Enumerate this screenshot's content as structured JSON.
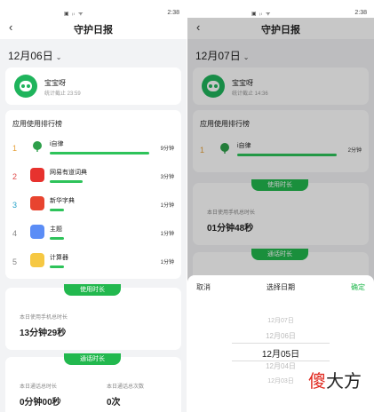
{
  "status": {
    "time": "2:38",
    "icons_left": "▣ ᵢₗ ᯤ",
    "icons_right": "◉ ✕ ⊛ ▭"
  },
  "header": {
    "title": "守护日报",
    "back": "‹"
  },
  "left": {
    "date": "12月06日",
    "user": {
      "name": "宝宝呀",
      "subtitle": "统计截止 23:59"
    },
    "ranking": {
      "title": "应用使用排行榜",
      "items": [
        {
          "rank": "1",
          "name": "i自律",
          "time": "9分钟",
          "ratio": 1.0,
          "color": "#e6a23c",
          "icon_color": "#ffffff"
        },
        {
          "rank": "2",
          "name": "网易有道词典",
          "time": "3分钟",
          "ratio": 0.33,
          "color": "#e04b4b",
          "icon_color": "#e7322e",
          "icon_text": "有道"
        },
        {
          "rank": "3",
          "name": "新华字典",
          "time": "1分钟",
          "ratio": 0.14,
          "color": "#27a3c9",
          "icon_color": "#e8442f",
          "icon_text": "新华"
        },
        {
          "rank": "4",
          "name": "主题",
          "time": "1分钟",
          "ratio": 0.14,
          "color": "#888888",
          "icon_color": "#5b8df6"
        },
        {
          "rank": "5",
          "name": "计算器",
          "time": "1分钟",
          "ratio": 0.14,
          "color": "#888888",
          "icon_color": "#f6c843"
        }
      ]
    },
    "usage": {
      "pill": "使用时长",
      "label": "本日使用手机总时长",
      "value": "13分钟29秒"
    },
    "calls": {
      "pill": "通话时长",
      "label_duration": "本日通话总时长",
      "value_duration": "0分钟00秒",
      "label_count": "本日通话总次数",
      "value_count": "0次"
    }
  },
  "right": {
    "date": "12月07日",
    "user": {
      "name": "宝宝呀",
      "subtitle": "统计截止 14:36"
    },
    "ranking": {
      "title": "应用使用排行榜",
      "items": [
        {
          "rank": "1",
          "name": "i自律",
          "time": "2分钟",
          "ratio": 1.0
        }
      ]
    },
    "usage": {
      "pill": "使用时长",
      "label": "本日使用手机总时长",
      "value": "01分钟48秒"
    },
    "calls": {
      "pill": "通话时长"
    },
    "picker": {
      "cancel": "取消",
      "title": "选择日期",
      "confirm": "确定",
      "options": [
        "12月07日",
        "12月06日",
        "12月05日",
        "12月04日",
        "12月03日"
      ],
      "selected_index": 2
    }
  },
  "watermark": {
    "char1": "傻",
    "rest": "大方"
  }
}
